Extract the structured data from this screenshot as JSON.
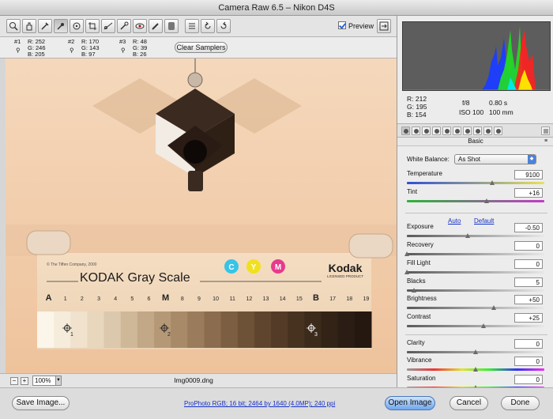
{
  "window": {
    "title": "Camera Raw 6.5  –  Nikon D4S"
  },
  "toolbar": {
    "tools": [
      {
        "name": "zoom-icon",
        "glyph": "zoom"
      },
      {
        "name": "hand-icon",
        "glyph": "hand"
      },
      {
        "name": "white-balance-icon",
        "glyph": "eyedropper"
      },
      {
        "name": "color-sampler-icon",
        "glyph": "sampler"
      },
      {
        "name": "target-adjust-icon",
        "glyph": "target"
      },
      {
        "name": "crop-icon",
        "glyph": "crop"
      },
      {
        "name": "straighten-icon",
        "glyph": "straighten"
      },
      {
        "name": "spot-removal-icon",
        "glyph": "spot"
      },
      {
        "name": "red-eye-icon",
        "glyph": "eye"
      },
      {
        "name": "adjustment-brush-icon",
        "glyph": "brush"
      },
      {
        "name": "graduated-filter-icon",
        "glyph": "gradient"
      },
      {
        "name": "preferences-icon",
        "glyph": "list"
      },
      {
        "name": "rotate-left-icon",
        "glyph": "rotl"
      },
      {
        "name": "rotate-right-icon",
        "glyph": "rotr"
      }
    ],
    "preview_label": "Preview",
    "preview_checked": true
  },
  "samplers": [
    {
      "label": "#1",
      "r": "R: 252",
      "g": "G: 246",
      "b": "B: 205"
    },
    {
      "label": "#2",
      "r": "R: 170",
      "g": "G: 143",
      "b": "B:   97"
    },
    {
      "label": "#3",
      "r": "R:   48",
      "g": "G:   39",
      "b": "B:   26"
    }
  ],
  "clear_samplers_label": "Clear Samplers",
  "photo": {
    "copyright": "© The Tiffen Company, 2000",
    "product": "KODAK Gray Scale",
    "brand": "Kodak",
    "brand_sub": "LICENSED PRODUCT",
    "cym": [
      "C",
      "Y",
      "M"
    ],
    "scale_labels": [
      "A",
      "1",
      "2",
      "3",
      "4",
      "5",
      "6",
      "M",
      "8",
      "9",
      "10",
      "11",
      "12",
      "13",
      "14",
      "15",
      "B",
      "17",
      "18",
      "19"
    ],
    "marker_labels": [
      "1",
      "2",
      "3"
    ]
  },
  "bottombar": {
    "zoom_minus": "−",
    "zoom_plus": "+",
    "zoom_value": "100%",
    "filename": "Img0009.dng"
  },
  "readout": {
    "r": "R:   212",
    "g": "G:   195",
    "b": "B:   154",
    "aperture": "f/8",
    "shutter": "0.80 s",
    "iso": "ISO 100",
    "focal": "100 mm"
  },
  "panel": {
    "title": "Basic",
    "white_balance_label": "White Balance:",
    "white_balance_value": "As Shot",
    "auto_label": "Auto",
    "default_label": "Default",
    "sliders": [
      {
        "key": "temperature",
        "label": "Temperature",
        "value": "9100",
        "fraction": 0.62
      },
      {
        "key": "tint",
        "label": "Tint",
        "value": "+16",
        "fraction": 0.58
      },
      {
        "key": "exposure",
        "label": "Exposure",
        "value": "-0.50",
        "fraction": 0.44
      },
      {
        "key": "recovery",
        "label": "Recovery",
        "value": "0",
        "fraction": 0.0
      },
      {
        "key": "fill-light",
        "label": "Fill Light",
        "value": "0",
        "fraction": 0.0
      },
      {
        "key": "blacks",
        "label": "Blacks",
        "value": "5",
        "fraction": 0.05
      },
      {
        "key": "brightness",
        "label": "Brightness",
        "value": "+50",
        "fraction": 0.63
      },
      {
        "key": "contrast",
        "label": "Contrast",
        "value": "+25",
        "fraction": 0.56
      },
      {
        "key": "clarity",
        "label": "Clarity",
        "value": "0",
        "fraction": 0.5
      },
      {
        "key": "vibrance",
        "label": "Vibrance",
        "value": "0",
        "fraction": 0.5
      },
      {
        "key": "saturation",
        "label": "Saturation",
        "value": "0",
        "fraction": 0.5
      }
    ]
  },
  "footer": {
    "save_image": "Save Image...",
    "workflow": "ProPhoto RGB; 16 bit; 2464 by 1640 (4.0MP); 240 ppi",
    "open_image": "Open Image",
    "cancel": "Cancel",
    "done": "Done"
  },
  "colors": {
    "accent": "#4d82d6",
    "photo_background": "#f3d4b6",
    "link": "#1530c9"
  }
}
